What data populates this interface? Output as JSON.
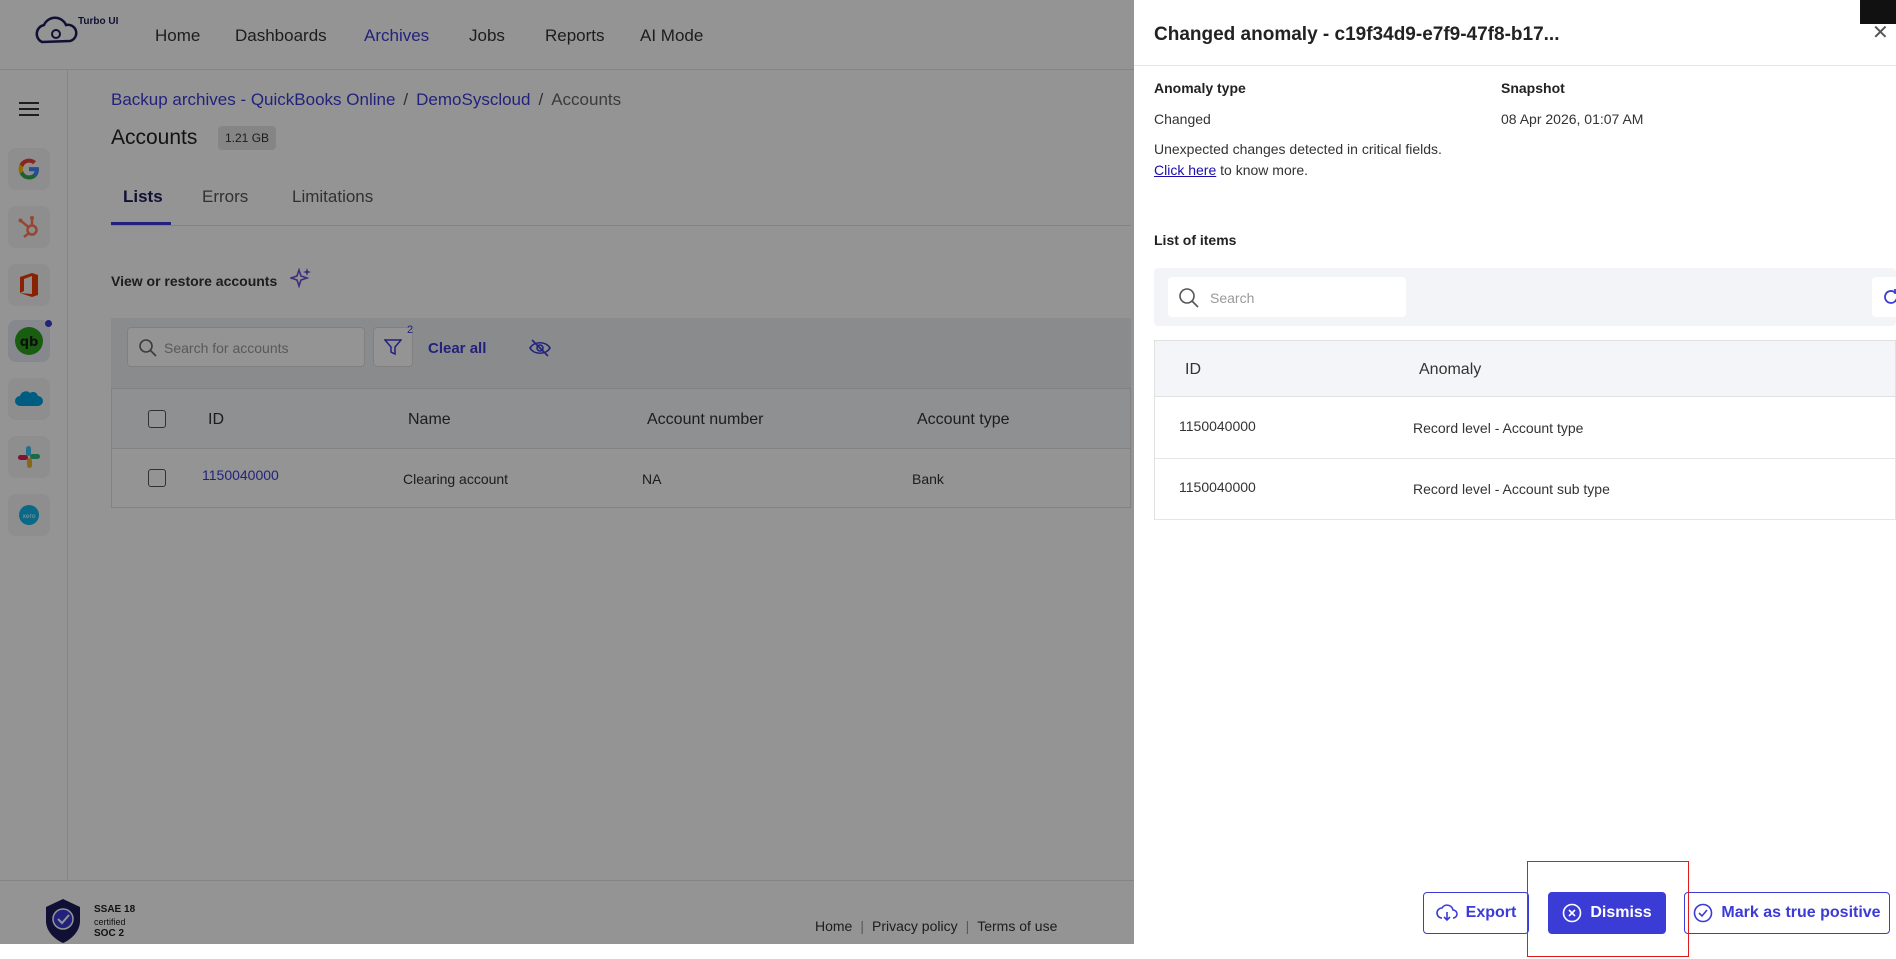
{
  "brand": {
    "name": "Turbo UI"
  },
  "nav": {
    "items": [
      {
        "label": "Home"
      },
      {
        "label": "Dashboards"
      },
      {
        "label": "Archives"
      },
      {
        "label": "Jobs"
      },
      {
        "label": "Reports"
      },
      {
        "label": "AI Mode"
      }
    ],
    "active": "Archives"
  },
  "breadcrumb": {
    "root": "Backup archives - QuickBooks Online",
    "org": "DemoSyscloud",
    "current": "Accounts"
  },
  "page": {
    "title": "Accounts",
    "size_badge": "1.21 GB"
  },
  "tabs": {
    "lists": "Lists",
    "errors": "Errors",
    "limitations": "Limitations"
  },
  "section": {
    "view_label": "View or restore accounts"
  },
  "filters": {
    "search_placeholder": "Search for accounts",
    "filter_count": "2",
    "clear_all": "Clear all"
  },
  "table": {
    "headers": {
      "id": "ID",
      "name": "Name",
      "account_number": "Account number",
      "account_type": "Account type"
    },
    "rows": [
      {
        "id": "1150040000",
        "name": "Clearing account",
        "account_number": "NA",
        "account_type": "Bank"
      }
    ]
  },
  "footer": {
    "soc_line1": "SSAE 18",
    "soc_line2": "certified",
    "soc_line3": "SOC 2",
    "links": {
      "home": "Home",
      "privacy": "Privacy policy",
      "terms": "Terms of use"
    }
  },
  "panel": {
    "title": "Changed anomaly - c19f34d9-e7f9-47f8-b17...",
    "anomaly_type_label": "Anomaly type",
    "anomaly_type_value": "Changed",
    "snapshot_label": "Snapshot",
    "snapshot_value": "08 Apr 2026, 01:07 AM",
    "description": "Unexpected changes detected in critical fields.",
    "click_here": "Click here",
    "know_more": " to know more.",
    "list_label": "List of items",
    "search_placeholder": "Search",
    "table_headers": {
      "id": "ID",
      "anomaly": "Anomaly"
    },
    "rows": [
      {
        "id": "1150040000",
        "anomaly": "Record level - Account type"
      },
      {
        "id": "1150040000",
        "anomaly": "Record level - Account sub type"
      }
    ],
    "buttons": {
      "export": "Export",
      "dismiss": "Dismiss",
      "mark_true": "Mark as true positive"
    }
  },
  "colors": {
    "accent": "#3b3bd6",
    "highlight": "#e01b1b"
  }
}
